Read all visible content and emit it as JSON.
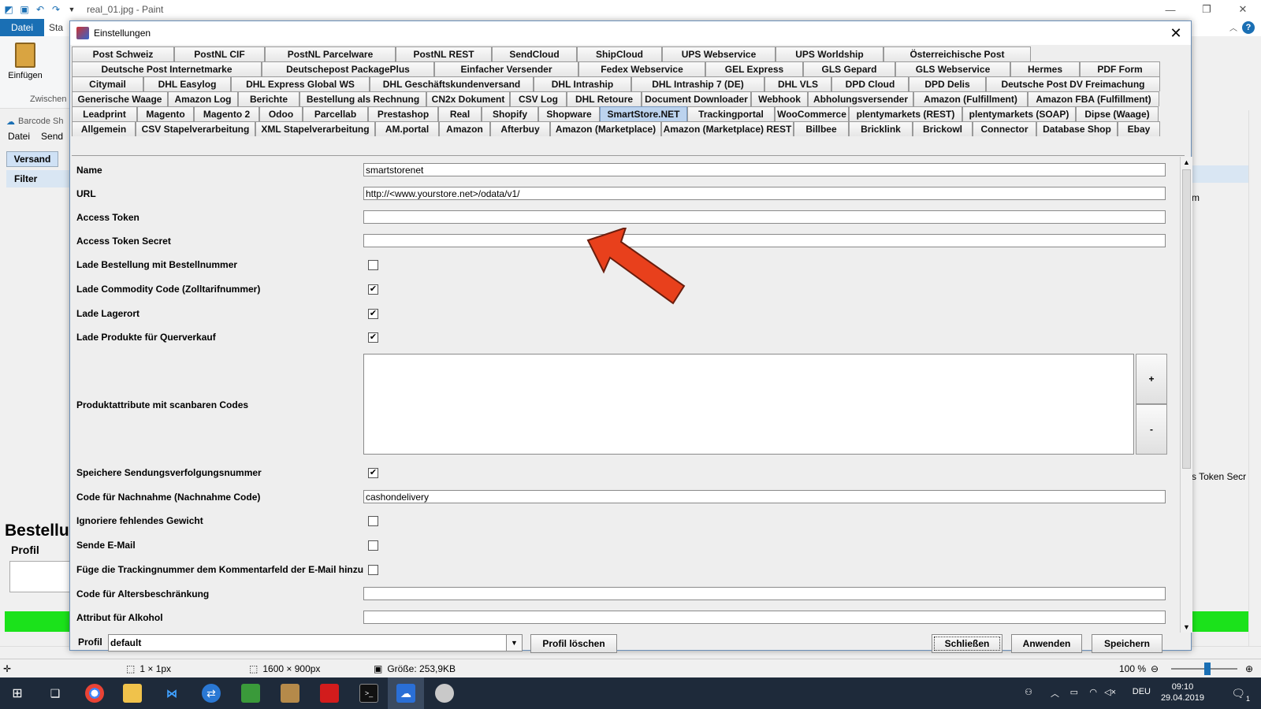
{
  "paint": {
    "window_title": "real_01.jpg - Paint",
    "file_tab": "Datei",
    "second_tab": "Sta",
    "paste_label": "Einfügen",
    "clipboard_group": "Zwischen"
  },
  "background_app": {
    "title": "Barcode Sh",
    "menu": [
      "Datei",
      "Send"
    ],
    "tab": "Versand",
    "filter": "Filter",
    "heading": "Bestellu",
    "profil": "Profil",
    "right_m": "m",
    "right_token": "s Token Secr"
  },
  "dialog": {
    "title": "Einstellungen",
    "tab_rows": [
      [
        "Post Schweiz",
        "PostNL CIF",
        "PostNL Parcelware",
        "PostNL REST",
        "SendCloud",
        "ShipCloud",
        "UPS Webservice",
        "UPS Worldship",
        "Österreichische Post"
      ],
      [
        "Deutsche Post Internetmarke",
        "Deutschepost PackagePlus",
        "Einfacher Versender",
        "Fedex Webservice",
        "GEL Express",
        "GLS Gepard",
        "GLS Webservice",
        "Hermes",
        "PDF Form"
      ],
      [
        "Citymail",
        "DHL Easylog",
        "DHL Express Global WS",
        "DHL Geschäftskundenversand",
        "DHL Intraship",
        "DHL Intraship 7 (DE)",
        "DHL VLS",
        "DPD Cloud",
        "DPD Delis",
        "Deutsche Post DV Freimachung"
      ],
      [
        "Generische Waage",
        "Amazon Log",
        "Berichte",
        "Bestellung als Rechnung",
        "CN2x Dokument",
        "CSV Log",
        "DHL Retoure",
        "Document Downloader",
        "Webhook",
        "Abholungsversender",
        "Amazon (Fulfillment)",
        "Amazon FBA (Fulfillment)"
      ],
      [
        "Leadprint",
        "Magento",
        "Magento 2",
        "Odoo",
        "Parcellab",
        "Prestashop",
        "Real",
        "Shopify",
        "Shopware",
        "SmartStore.NET",
        "Trackingportal",
        "WooCommerce",
        "plentymarkets (REST)",
        "plentymarkets (SOAP)",
        "Dipse (Waage)"
      ],
      [
        "Allgemein",
        "CSV Stapelverarbeitung",
        "XML Stapelverarbeitung",
        "AM.portal",
        "Amazon",
        "Afterbuy",
        "Amazon (Marketplace)",
        "Amazon (Marketplace) REST",
        "Billbee",
        "Bricklink",
        "Brickowl",
        "Connector",
        "Database Shop",
        "Ebay"
      ]
    ],
    "selected_tab": "SmartStore.NET",
    "fields": {
      "name_label": "Name",
      "name_value": "smartstorenet",
      "url_label": "URL",
      "url_value": "http://<www.yourstore.net>/odata/v1/",
      "token_label": "Access Token",
      "token_value": "",
      "secret_label": "Access Token Secret",
      "secret_value": "",
      "lade_bestellung": "Lade Bestellung mit Bestellnummer",
      "lade_commodity": "Lade Commodity Code (Zolltarifnummer)",
      "lade_lagerort": "Lade Lagerort",
      "lade_produkte": "Lade Produkte für Querverkauf",
      "produktattribute": "Produktattribute mit scanbaren Codes",
      "plus": "+",
      "minus": "-",
      "speichere": "Speichere Sendungsverfolgungsnummer",
      "nachnahme_label": "Code für Nachnahme (Nachnahme Code)",
      "nachnahme_value": "cashondelivery",
      "ignoriere": "Ignoriere fehlendes Gewicht",
      "sende": "Sende E-Mail",
      "fuege": "Füge die Trackingnummer dem Kommentarfeld der E-Mail hinzu",
      "alter_label": "Code für Altersbeschränkung",
      "alkohol_label": "Attribut für Alkohol"
    },
    "checks": {
      "lade_bestellung": false,
      "lade_commodity": true,
      "lade_lagerort": true,
      "lade_produkte": true,
      "speichere": true,
      "ignoriere": false,
      "sende": false,
      "fuege": false
    },
    "bottom": {
      "profil_label": "Profil",
      "profil_value": "default",
      "delete_btn": "Profil löschen",
      "close_btn": "Schließen",
      "apply_btn": "Anwenden",
      "save_btn": "Speichern"
    }
  },
  "statusbar": {
    "selection": "1 × 1px",
    "dimensions": "1600 × 900px",
    "size": "Größe: 253,9KB",
    "zoom": "100 %",
    "zoom_level": 0.55
  },
  "taskbar": {
    "language": "DEU",
    "time": "09:10",
    "date": "29.04.2019",
    "notifications": "1"
  },
  "colors": {
    "accent": "#1a6fb4",
    "selected_tab": "#bcd3ee",
    "green_status": "#1be21b",
    "arrow": "#e8401c"
  }
}
